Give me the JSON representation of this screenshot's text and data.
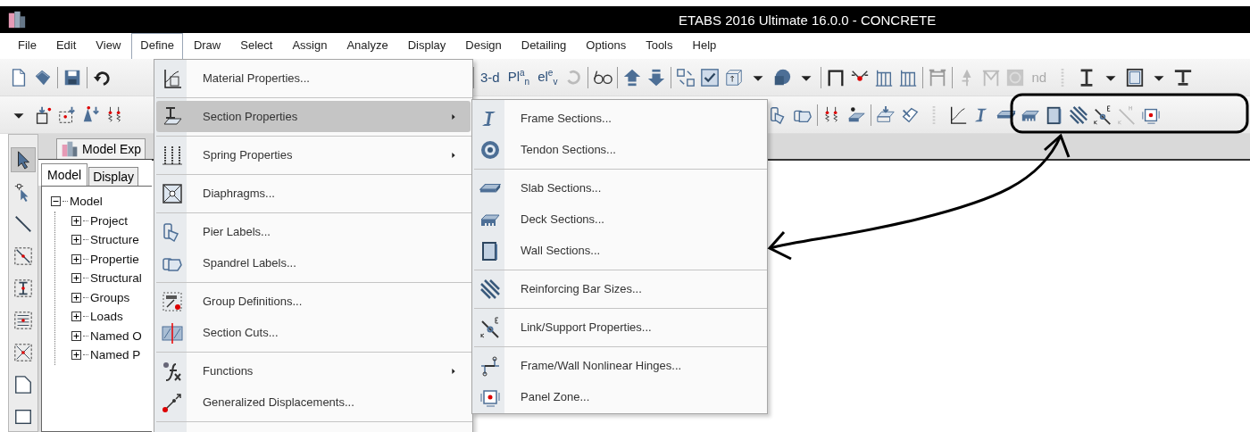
{
  "window": {
    "title": "ETABS 2016 Ultimate 16.0.0 - CONCRETE"
  },
  "menu_bar": [
    {
      "label": "File",
      "selected": false
    },
    {
      "label": "Edit",
      "selected": false
    },
    {
      "label": "View",
      "selected": false
    },
    {
      "label": "Define",
      "selected": true
    },
    {
      "label": "Draw",
      "selected": false
    },
    {
      "label": "Select",
      "selected": false
    },
    {
      "label": "Assign",
      "selected": false
    },
    {
      "label": "Analyze",
      "selected": false
    },
    {
      "label": "Display",
      "selected": false
    },
    {
      "label": "Design",
      "selected": false
    },
    {
      "label": "Detailing",
      "selected": false
    },
    {
      "label": "Options",
      "selected": false
    },
    {
      "label": "Tools",
      "selected": false
    },
    {
      "label": "Help",
      "selected": false
    }
  ],
  "toolbar": {
    "text_buttons": [
      {
        "label": "3-d",
        "disabled": false
      },
      {
        "label": "Pl$^{a}$$_{n}$",
        "disabled": false
      },
      {
        "label": "el$^{e}$$_{v}$",
        "disabled": false
      },
      {
        "label": "nd",
        "disabled": true
      }
    ]
  },
  "vertical_toolbar": {
    "tools": [
      {
        "selected": true
      },
      {
        "selected": false
      },
      {
        "selected": false
      },
      {
        "selected": false
      },
      {
        "selected": false
      },
      {
        "selected": false
      },
      {
        "selected": false
      },
      {
        "selected": false
      },
      {
        "selected": false
      }
    ]
  },
  "model_explorer": {
    "title": "Model Exp",
    "tabs": [
      {
        "label": "Model",
        "selected": true
      },
      {
        "label": "Display",
        "selected": false
      }
    ],
    "tree": [
      {
        "label": "Model",
        "expanded": true,
        "children": [
          {
            "label": "Project",
            "expanded": false
          },
          {
            "label": "Structure",
            "expanded": false
          },
          {
            "label": "Propertie",
            "expanded": false
          },
          {
            "label": "Structural",
            "expanded": false
          },
          {
            "label": "Groups",
            "expanded": false
          },
          {
            "label": "Loads",
            "expanded": false
          },
          {
            "label": "Named O",
            "expanded": false
          },
          {
            "label": "Named P",
            "expanded": false
          }
        ]
      }
    ]
  },
  "define_menu": {
    "items": [
      {
        "kind": "item",
        "label": "Material Properties...",
        "selected": false
      },
      {
        "kind": "separator"
      },
      {
        "kind": "submenu",
        "label": "Section Properties",
        "selected": true
      },
      {
        "kind": "separator"
      },
      {
        "kind": "submenu",
        "label": "Spring Properties",
        "selected": false
      },
      {
        "kind": "separator"
      },
      {
        "kind": "item",
        "label": "Diaphragms...",
        "selected": false
      },
      {
        "kind": "separator"
      },
      {
        "kind": "item",
        "label": "Pier Labels...",
        "selected": false
      },
      {
        "kind": "item",
        "label": "Spandrel Labels...",
        "selected": false
      },
      {
        "kind": "separator"
      },
      {
        "kind": "item",
        "label": "Group Definitions...",
        "selected": false
      },
      {
        "kind": "item",
        "label": "Section Cuts...",
        "selected": false
      },
      {
        "kind": "separator"
      },
      {
        "kind": "submenu",
        "label": "Functions",
        "selected": false
      },
      {
        "kind": "item",
        "label": "Generalized Displacements...",
        "selected": false
      },
      {
        "kind": "separator"
      }
    ]
  },
  "section_properties_submenu": {
    "items": [
      {
        "kind": "item",
        "label": "Frame Sections...",
        "selected": false
      },
      {
        "kind": "item",
        "label": "Tendon Sections...",
        "selected": false
      },
      {
        "kind": "separator"
      },
      {
        "kind": "item",
        "label": "Slab Sections...",
        "selected": false
      },
      {
        "kind": "item",
        "label": "Deck Sections...",
        "selected": false
      },
      {
        "kind": "item",
        "label": "Wall Sections...",
        "selected": false
      },
      {
        "kind": "separator"
      },
      {
        "kind": "item",
        "label": "Reinforcing Bar Sizes...",
        "selected": false
      },
      {
        "kind": "separator"
      },
      {
        "kind": "item",
        "label": "Link/Support Properties...",
        "selected": false
      },
      {
        "kind": "separator"
      },
      {
        "kind": "item",
        "label": "Frame/Wall Nonlinear Hinges...",
        "selected": false
      },
      {
        "kind": "item",
        "label": "Panel Zone...",
        "selected": false
      }
    ]
  }
}
